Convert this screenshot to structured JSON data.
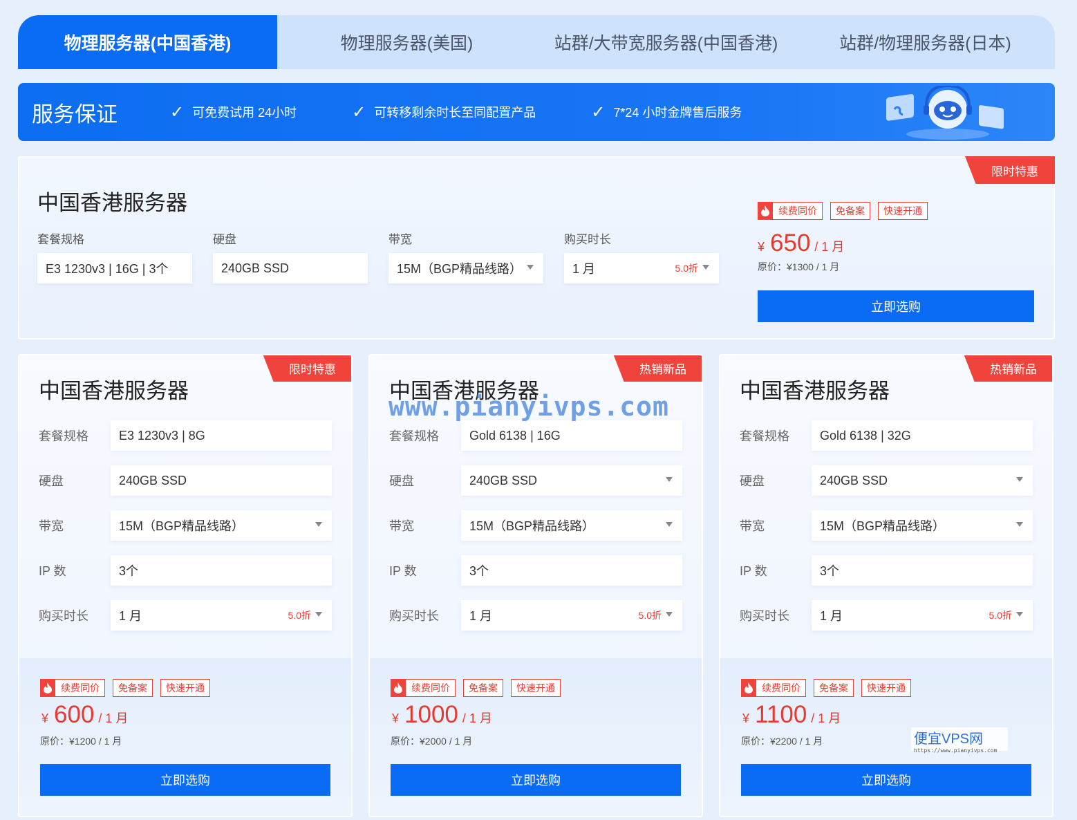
{
  "tabs": [
    {
      "label": "物理服务器(中国香港)",
      "active": true
    },
    {
      "label": "物理服务器(美国)",
      "active": false
    },
    {
      "label": "站群/大带宽服务器(中国香港)",
      "active": false
    },
    {
      "label": "站群/物理服务器(日本)",
      "active": false
    }
  ],
  "guarantee": {
    "title": "服务保证",
    "items": [
      "可免费试用 24小时",
      "可转移剩余时长至同配置产品",
      "7*24 小时金牌售后服务"
    ]
  },
  "labels": {
    "spec": "套餐规格",
    "disk": "硬盘",
    "bandwidth": "带宽",
    "ip": "IP 数",
    "duration": "购买时长",
    "buy": "立即选购",
    "yen": "¥",
    "tag_renew": "续费同价",
    "tag_nofiling": "免备案",
    "tag_fast": "快速开通"
  },
  "featured": {
    "title": "中国香港服务器",
    "badge": "限时特惠",
    "spec": "E3 1230v3 | 16G | 3个",
    "disk": "240GB SSD",
    "bandwidth": "15M（BGP精品线路）",
    "duration": "1 月",
    "discount": "5.0折",
    "price": "650",
    "per": "/ 1 月",
    "original": "原价：¥1300 / 1 月"
  },
  "cards": [
    {
      "title": "中国香港服务器",
      "badge": "限时特惠",
      "spec": "E3 1230v3 | 8G",
      "disk": "240GB SSD",
      "bandwidth": "15M（BGP精品线路）",
      "ip": "3个",
      "duration": "1 月",
      "discount": "5.0折",
      "price": "600",
      "per": "/ 1 月",
      "original": "原价：¥1200 / 1 月"
    },
    {
      "title": "中国香港服务器",
      "badge": "热销新品",
      "spec": "Gold 6138 | 16G",
      "disk": "240GB SSD",
      "bandwidth": "15M（BGP精品线路）",
      "ip": "3个",
      "duration": "1 月",
      "discount": "5.0折",
      "price": "1000",
      "per": "/ 1 月",
      "original": "原价：¥2000 / 1 月"
    },
    {
      "title": "中国香港服务器",
      "badge": "热销新品",
      "spec": "Gold 6138 | 32G",
      "disk": "240GB SSD",
      "bandwidth": "15M（BGP精品线路）",
      "ip": "3个",
      "duration": "1 月",
      "discount": "5.0折",
      "price": "1100",
      "per": "/ 1 月",
      "original": "原价：¥2200 / 1 月"
    }
  ],
  "watermark": {
    "text": "www.pianyivps.com",
    "logo": "便宜VPS网",
    "logo_url": "https://www.pianyivps.com"
  },
  "colors": {
    "primary": "#0a6cf5",
    "accent_red": "#f0433b"
  }
}
